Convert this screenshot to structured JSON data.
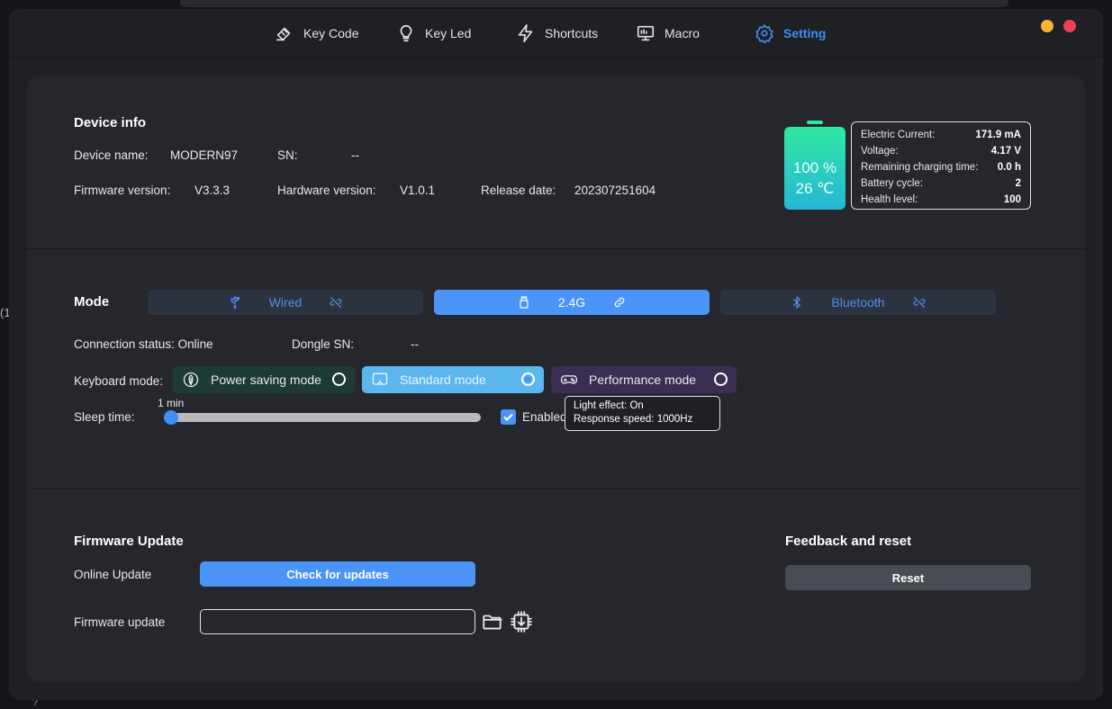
{
  "nav": {
    "items": [
      {
        "label": "Key Code",
        "icon": "key-code-icon"
      },
      {
        "label": "Key Led",
        "icon": "bulb-icon"
      },
      {
        "label": "Shortcuts",
        "icon": "lightning-icon"
      },
      {
        "label": "Macro",
        "icon": "monitor-icon"
      },
      {
        "label": "Setting",
        "icon": "gear-icon"
      }
    ],
    "active": "Setting"
  },
  "colors": {
    "accent": "#4a94f8",
    "minimize": "#f6b23a",
    "close": "#ee4054"
  },
  "background": {
    "left_text": "(1",
    "bottom_text": "?"
  },
  "device_info": {
    "title": "Device info",
    "device_name_label": "Device name:",
    "device_name": "MODERN97",
    "sn_label": "SN:",
    "sn": "--",
    "firmware_label": "Firmware version:",
    "firmware": "V3.3.3",
    "hardware_label": "Hardware version:",
    "hardware": "V1.0.1",
    "release_label": "Release date:",
    "release": "202307251604"
  },
  "battery": {
    "percent": "100 %",
    "temperature": "26 ℃",
    "stats": [
      {
        "label": "Electric Current:",
        "value": "171.9 mA"
      },
      {
        "label": "Voltage:",
        "value": "4.17 V"
      },
      {
        "label": "Remaining charging time:",
        "value": "0.0 h"
      },
      {
        "label": "Battery cycle:",
        "value": "2"
      },
      {
        "label": "Health level:",
        "value": "100"
      }
    ]
  },
  "mode": {
    "title": "Mode",
    "tabs": [
      {
        "label": "Wired",
        "icon": "usb-icon",
        "status_icon": "unlink-icon",
        "active": false
      },
      {
        "label": "2.4G",
        "icon": "dongle-icon",
        "status_icon": "link-icon",
        "active": true
      },
      {
        "label": "Bluetooth",
        "icon": "bluetooth-icon",
        "status_icon": "unlink-icon",
        "active": false
      }
    ],
    "connection_status": "Connection status: Online",
    "dongle_sn_label": "Dongle SN:",
    "dongle_sn": "--",
    "keyboard_mode_label": "Keyboard mode:",
    "keyboard_modes": [
      {
        "label": "Power saving mode",
        "icon": "leaf-icon",
        "selected": false
      },
      {
        "label": "Standard mode",
        "icon": "screen-icon",
        "selected": true
      },
      {
        "label": "Performance mode",
        "icon": "gamepad-icon",
        "selected": false
      }
    ],
    "sleep_time_label": "Sleep time:",
    "sleep_value": "1 min",
    "sleep_fraction": 0.0,
    "enabled_label": "Enabled",
    "enabled": true,
    "tooltip": {
      "line1": "Light effect: On",
      "line2": "Response speed: 1000Hz"
    }
  },
  "firmware_update": {
    "title": "Firmware Update",
    "online_label": "Online Update",
    "check_button": "Check for updates",
    "file_label": "Firmware update",
    "file_value": ""
  },
  "feedback": {
    "title": "Feedback and reset",
    "reset_button": "Reset"
  }
}
